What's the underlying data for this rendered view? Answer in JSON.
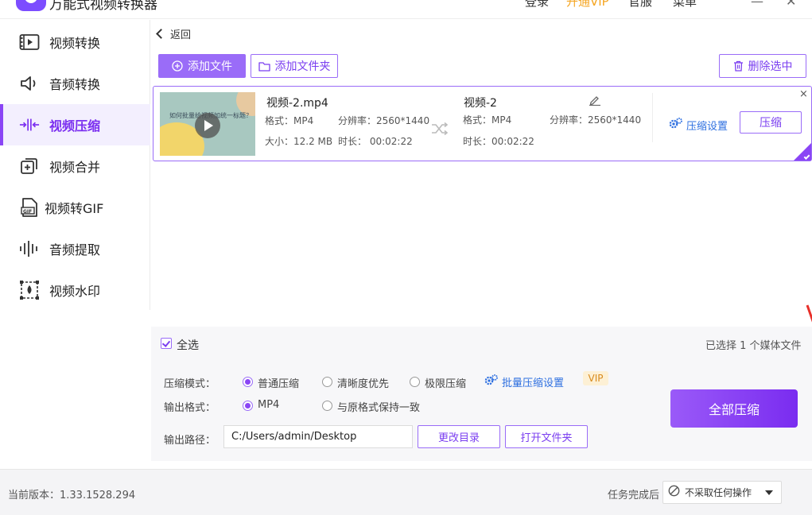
{
  "app": {
    "title": "万能式视频转换器",
    "top_links": [
      "登录",
      "开通VIP",
      "官服",
      "菜单"
    ],
    "accent": "#8a45f5"
  },
  "sidebar": {
    "items": [
      {
        "label": "视频转换",
        "icon": "video-convert-icon"
      },
      {
        "label": "音频转换",
        "icon": "audio-convert-icon"
      },
      {
        "label": "视频压缩",
        "icon": "compress-icon",
        "active": true
      },
      {
        "label": "视频合并",
        "icon": "merge-icon"
      },
      {
        "label": "视频转GIF",
        "icon": "gif-icon"
      },
      {
        "label": "音频提取",
        "icon": "audio-extract-icon"
      },
      {
        "label": "视频水印",
        "icon": "watermark-icon"
      }
    ]
  },
  "toolbar": {
    "back": "返回",
    "add_file": "添加文件",
    "add_folder": "添加文件夹",
    "delete_selected": "删除选中"
  },
  "file": {
    "thumb_text": "如何批量给视频加统一标题？",
    "name": "视频-2.mp4",
    "format": "格式：MP4",
    "resolution": "分辨率：2560*1440",
    "size": "大小：12.2 MB",
    "duration": "时长：   00:02:22",
    "out_name": "视频-2",
    "out_format": "格式：MP4",
    "out_resolution": "分辨率：2560*1440",
    "out_duration": "时长：00:02:22",
    "compress_settings": "压缩设置",
    "compress": "压缩",
    "close": "×"
  },
  "selection": {
    "select_all": "全选",
    "selected_count": "已选择 1 个媒体文件"
  },
  "settings": {
    "mode_label": "压缩模式：",
    "modes": [
      "普通压缩",
      "清晰度优先",
      "极限压缩"
    ],
    "mode_selected": "普通压缩",
    "batch_settings": "批量压缩设置",
    "vip": "VIP",
    "format_label": "输出格式：",
    "formats": [
      "MP4",
      "与原格式保持一致"
    ],
    "format_selected": "MP4",
    "path_label": "输出路径：",
    "path_value": "C:/Users/admin/Desktop",
    "change_dir": "更改目录",
    "open_folder": "打开文件夹",
    "compress_all": "全部压缩"
  },
  "status": {
    "version": "当前版本：1.33.1528.294",
    "after_label": "任务完成后",
    "after_value": "不采取任何操作"
  }
}
